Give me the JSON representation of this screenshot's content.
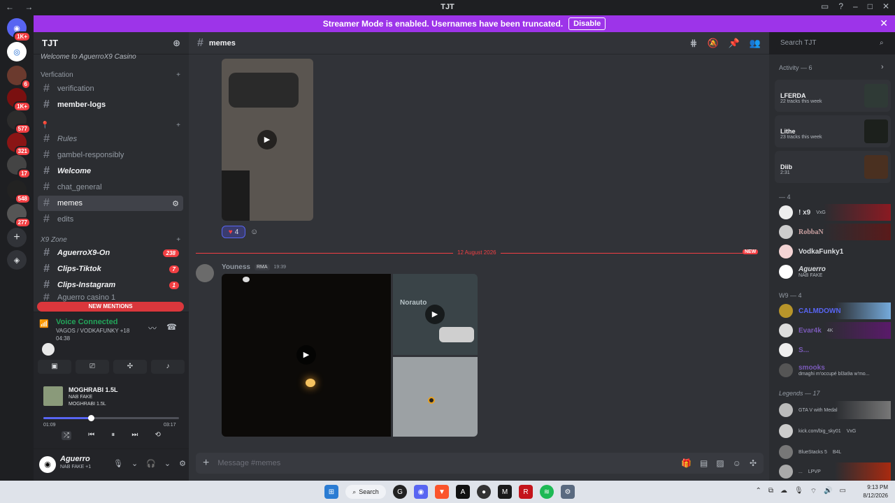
{
  "window": {
    "title": "TJT"
  },
  "banner": {
    "text": "Streamer Mode is enabled. Usernames have been truncated.",
    "button": "Disable"
  },
  "server_rail": {
    "badges": [
      "1K+",
      "6",
      "1K+",
      "577",
      "321",
      "17",
      "548",
      "277"
    ]
  },
  "server": {
    "name": "TJT"
  },
  "sidebar": {
    "top_item": "Welcome to AguerroX9 Casino",
    "category_verification": "Verfication",
    "channels": [
      {
        "name": "verification"
      },
      {
        "name": "member-logs"
      },
      {
        "name": "Rules"
      },
      {
        "name": "gambel-responsibly"
      },
      {
        "name": "Welcome"
      },
      {
        "name": "chat_general"
      },
      {
        "name": "memes"
      },
      {
        "name": "edits"
      }
    ],
    "category_x9": "X9 Zone",
    "x9_channels": [
      {
        "name": "AguerroX9-On",
        "count": "238"
      },
      {
        "name": "Clips-Tiktok",
        "count": "7"
      },
      {
        "name": "Clips-Instagram",
        "count": "1"
      }
    ],
    "partial_item": "Aguerro casino 1",
    "new_mentions": "NEW MENTIONS"
  },
  "voice": {
    "status": "Voice Connected",
    "channel": "VAGOS / VODKAFUNKY +18",
    "timer": "04:38",
    "track_title": "MOGHRABI 1.5L",
    "track_artist": "NAB FAKE",
    "track_album": "MOGHRABI 1.5L",
    "elapsed": "01:09",
    "duration": "03:17",
    "progress": 0.35
  },
  "user": {
    "name": "Aguerro",
    "status": "NAB FAKE +1"
  },
  "chat": {
    "channel": "memes",
    "reaction_count": "4",
    "date_divider": "12 August 2026",
    "new_label": "NEW",
    "author": "Youness",
    "tag": "RMA",
    "time": "19:39",
    "composer_placeholder": "Message #memes"
  },
  "search": {
    "placeholder": "Search TJT"
  },
  "members": {
    "activity_header": "Activity — 6",
    "activities": [
      {
        "name": "LFERDA",
        "detail": "22 tracks this week"
      },
      {
        "name": "Lithe",
        "detail": "23 tracks this week"
      },
      {
        "name": "Diib",
        "detail": "2:31"
      }
    ],
    "group1": "— 4",
    "group1_members": [
      {
        "name": "! x9",
        "tag": "VxG"
      },
      {
        "name": "RobbaN"
      },
      {
        "name": "VodkaFunky1"
      },
      {
        "name": "Aguerro",
        "status": "NAB FAKE"
      }
    ],
    "group2": "W9 — 4",
    "group2_members": [
      {
        "name": "CALMDOWN"
      },
      {
        "name": "Evar4k",
        "tag": "4K"
      },
      {
        "name": "S..."
      },
      {
        "name": "smooks",
        "status": "dmaghi m'occupé bl3a9a w'mo..."
      }
    ],
    "group3": "Legends — 17",
    "group3_members": [
      {
        "name": "",
        "status": "GTA V with Medal"
      },
      {
        "name": "",
        "tag": "VxG",
        "status": "kick.com/big_sky01"
      },
      {
        "name": "",
        "tag": "B4L",
        "status": "BlueStacks 5"
      },
      {
        "name": "",
        "tag": "LPVP",
        "status": "..."
      }
    ]
  },
  "taskbar": {
    "search": "Search",
    "time": "9:13 PM",
    "date": "8/12/2026"
  }
}
